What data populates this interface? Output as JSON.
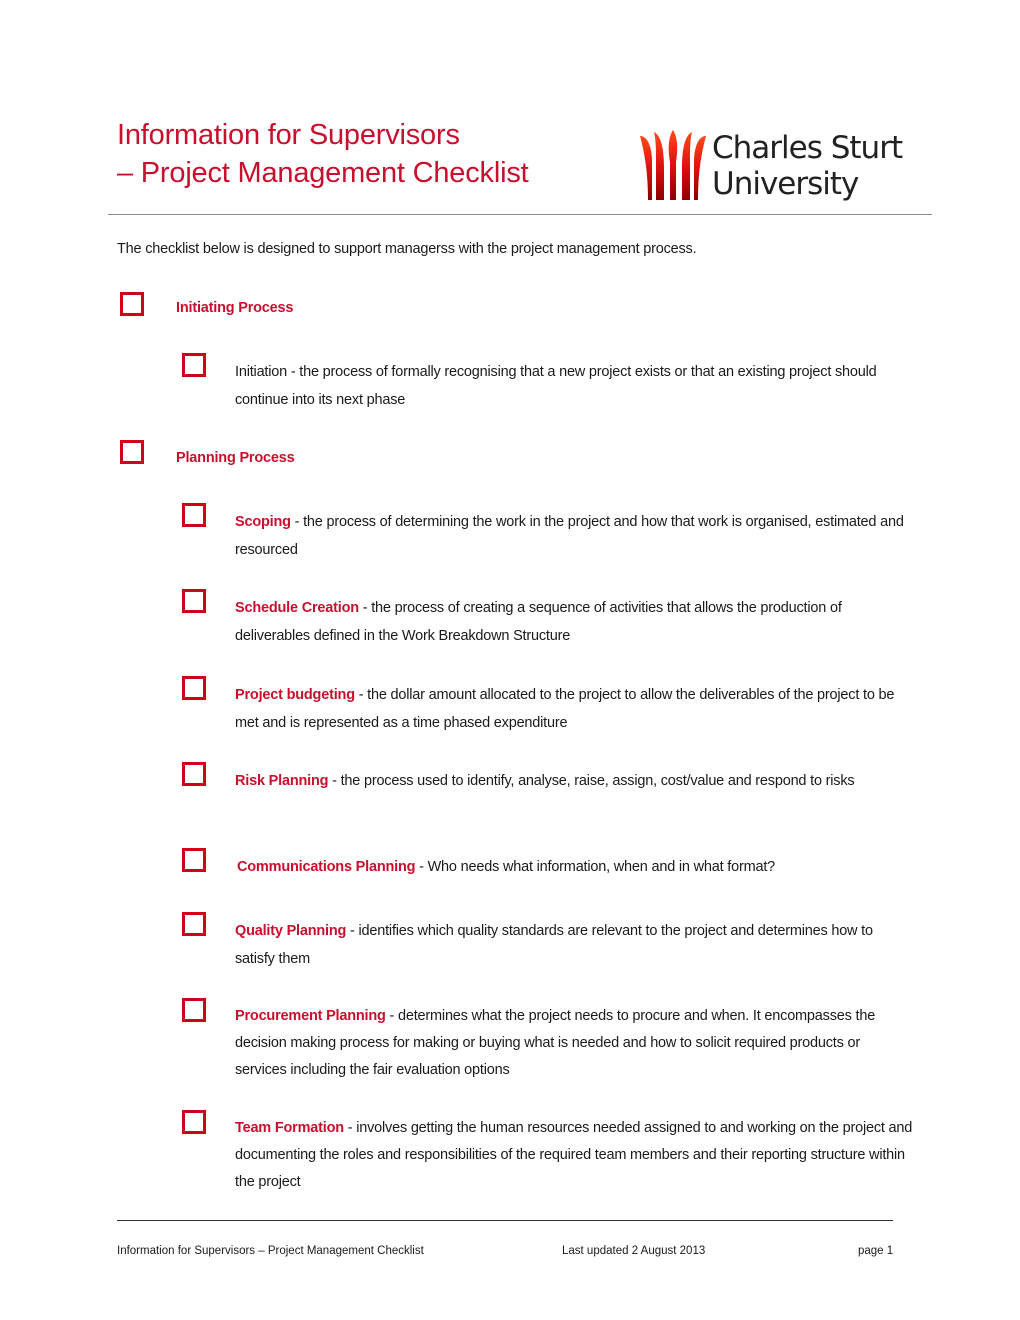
{
  "header": {
    "title_line1": "Information for Supervisors",
    "title_line2": "– Project Management Checklist",
    "logo": {
      "icon": "csu-tulip-icon",
      "line1": "Charles Sturt",
      "line2": "University"
    }
  },
  "intro": "The checklist below is designed to support managerss with the project management process.",
  "sections": [
    {
      "heading": "Initiating Process",
      "checked": false,
      "items": [
        {
          "term": "",
          "text": "Initiation - the process of formally recognising that a new project exists or that an existing project should continue into its next phase",
          "checked": false
        }
      ]
    },
    {
      "heading": "Planning Process",
      "checked": false,
      "items": [
        {
          "term": "Scoping",
          "text": " - the process of determining the work in the project and how that work is organised, estimated and resourced",
          "checked": false
        },
        {
          "term": "Schedule Creation",
          "text": " - the process of creating a sequence of activities that allows the production of deliverables defined in the Work Breakdown Structure",
          "checked": false
        },
        {
          "term": "Project budgeting",
          "text": " - the dollar amount allocated to the project to allow the deliverables of the project to be met and is represented as a time phased expenditure",
          "checked": false
        },
        {
          "term": "Risk Planning",
          "text": " - the process used to identify, analyse, raise, assign, cost/value and respond to risks",
          "checked": false
        },
        {
          "term": "Communications Planning",
          "text": " - Who needs what information, when and in what format?",
          "checked": false
        },
        {
          "term": "Quality Planning",
          "text": " - identifies which quality standards are relevant to the project and determines how to satisfy them",
          "checked": false
        },
        {
          "term": "Procurement Planning",
          "text": " - determines what the project needs to procure and when. It encompasses the decision making process for making or buying what is needed and how to solicit required products or services including the fair evaluation options",
          "checked": false
        },
        {
          "term": "Team Formation",
          "text": " - involves getting the human resources needed assigned to and working on the project and documenting the roles and responsibilities of the required team members and their reporting structure within the project",
          "checked": false
        }
      ]
    }
  ],
  "footer": {
    "doc_title": "Information for Supervisors – Project Management Checklist",
    "updated": "Last updated 2 August 2013",
    "page": "page 1"
  },
  "colors": {
    "accent": "#c8102e",
    "checkbox": "#d0021b"
  }
}
